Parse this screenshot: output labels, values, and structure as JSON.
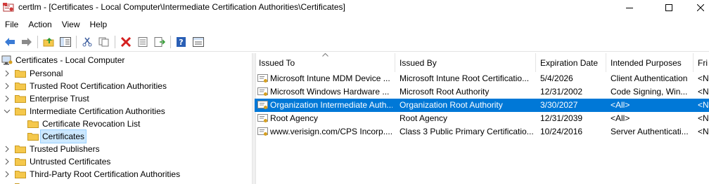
{
  "window": {
    "app_name": "certlm",
    "title": "certlm - [Certificates - Local Computer\\Intermediate Certification Authorities\\Certificates]"
  },
  "menu": [
    "File",
    "Action",
    "View",
    "Help"
  ],
  "toolbar": {
    "icons": [
      "back-icon",
      "forward-icon",
      "up-folder-icon",
      "show-hide-tree-icon",
      "cut-icon",
      "copy-icon",
      "delete-icon",
      "properties-icon",
      "export-icon",
      "help-icon",
      "view-icon"
    ]
  },
  "tree": {
    "root": "Certificates - Local Computer",
    "items": [
      {
        "label": "Personal",
        "level": 1,
        "expanded": false
      },
      {
        "label": "Trusted Root Certification Authorities",
        "level": 1,
        "expanded": false
      },
      {
        "label": "Enterprise Trust",
        "level": 1,
        "expanded": false
      },
      {
        "label": "Intermediate Certification Authorities",
        "level": 1,
        "expanded": true
      },
      {
        "label": "Certificate Revocation List",
        "level": 2,
        "expanded": false
      },
      {
        "label": "Certificates",
        "level": 2,
        "expanded": false,
        "selected": true
      },
      {
        "label": "Trusted Publishers",
        "level": 1,
        "expanded": false
      },
      {
        "label": "Untrusted Certificates",
        "level": 1,
        "expanded": false
      },
      {
        "label": "Third-Party Root Certification Authorities",
        "level": 1,
        "expanded": false
      }
    ]
  },
  "list": {
    "columns": [
      "Issued To",
      "Issued By",
      "Expiration Date",
      "Intended Purposes",
      "Fri"
    ],
    "sort_column": "Issued To",
    "rows": [
      {
        "issued_to": "Microsoft Intune MDM Device ...",
        "issued_by": "Microsoft Intune Root Certificatio...",
        "expiration": "5/4/2026",
        "purposes": "Client Authentication",
        "friendly": "<N"
      },
      {
        "issued_to": "Microsoft Windows Hardware ...",
        "issued_by": "Microsoft Root Authority",
        "expiration": "12/31/2002",
        "purposes": "Code Signing, Win...",
        "friendly": "<N"
      },
      {
        "issued_to": "Organization Intermediate Auth...",
        "issued_by": "Organization Root Authority",
        "expiration": "3/30/2027",
        "purposes": "<All>",
        "friendly": "<N",
        "selected": true
      },
      {
        "issued_to": "Root Agency",
        "issued_by": "Root Agency",
        "expiration": "12/31/2039",
        "purposes": "<All>",
        "friendly": "<N"
      },
      {
        "issued_to": "www.verisign.com/CPS Incorp....",
        "issued_by": "Class 3 Public Primary Certificatio...",
        "expiration": "10/24/2016",
        "purposes": "Server Authenticati...",
        "friendly": "<N"
      }
    ]
  },
  "colors": {
    "selection": "#0078d7",
    "tree_selection": "#cce8ff",
    "folder": "#f5c84c"
  }
}
